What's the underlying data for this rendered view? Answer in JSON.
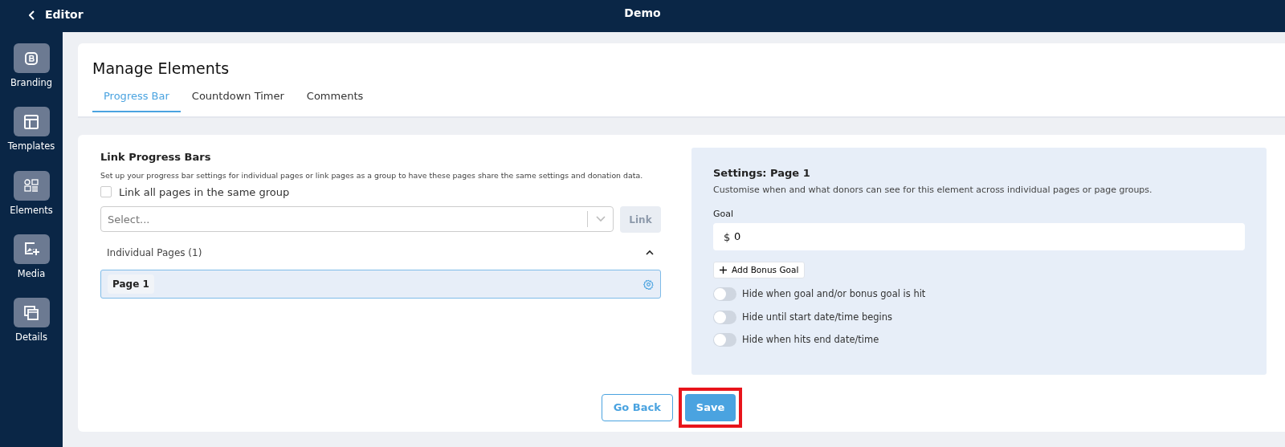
{
  "topbar": {
    "back_label": "Editor",
    "title": "Demo"
  },
  "sidebar": {
    "items": [
      {
        "label": "Branding"
      },
      {
        "label": "Templates"
      },
      {
        "label": "Elements"
      },
      {
        "label": "Media"
      },
      {
        "label": "Details"
      }
    ]
  },
  "header": {
    "title": "Manage Elements",
    "tabs": [
      {
        "label": "Progress Bar",
        "selected": true
      },
      {
        "label": "Countdown Timer",
        "selected": false
      },
      {
        "label": "Comments",
        "selected": false
      }
    ]
  },
  "link_section": {
    "title": "Link Progress Bars",
    "description": "Set up your progress bar settings for individual pages or link pages as a group to have these pages share the same settings and donation data.",
    "link_all": {
      "label": "Link all pages in the same group",
      "checked": false
    },
    "select": {
      "placeholder": "Select..."
    },
    "link_button": {
      "label": "Link",
      "disabled": true
    },
    "pages_header": {
      "label": "Individual Pages (1)",
      "expanded": true
    },
    "pages": [
      {
        "label": "Page 1",
        "selected": true
      }
    ]
  },
  "settings": {
    "title": "Settings: Page 1",
    "description": "Customise when and what donors can see for this element across individual pages or page groups.",
    "goal": {
      "label": "Goal",
      "currency": "$",
      "value": "0"
    },
    "bonus_button": {
      "label": "Add Bonus Goal"
    },
    "toggles": [
      {
        "label": "Hide when goal and/or bonus goal is hit",
        "on": false
      },
      {
        "label": "Hide until start date/time begins",
        "on": false
      },
      {
        "label": "Hide when hits end date/time",
        "on": false
      }
    ]
  },
  "footer": {
    "back_button": "Go Back",
    "save_button": {
      "label": "Save",
      "highlighted": true
    }
  }
}
